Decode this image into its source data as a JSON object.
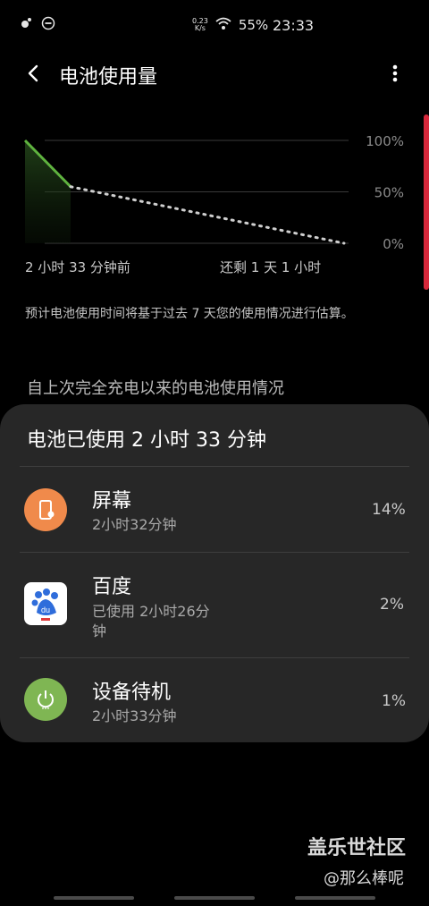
{
  "status_bar": {
    "speed_value": "0.23",
    "speed_unit": "K/s",
    "battery": "55%",
    "time": "23:33"
  },
  "app_bar": {
    "title": "电池使用量"
  },
  "chart_data": {
    "type": "line",
    "x_start_label": "2 小时 33 分钟前",
    "x_end_label": "还剩 1 天 1 小时",
    "y_tick_labels": [
      "100%",
      "50%",
      "0%"
    ],
    "ylim": [
      0,
      100
    ],
    "series": [
      {
        "values": [
          [
            0,
            100
          ],
          [
            1,
            55
          ]
        ]
      },
      {
        "values": [
          [
            1,
            55
          ],
          [
            7,
            0
          ]
        ]
      }
    ],
    "colors": {
      "actual": "#5fb33f",
      "predicted": "#cfcfcf",
      "grid": "#3a3a3a"
    }
  },
  "note": "预计电池使用时间将基于过去 7 天您的使用情况进行估算。",
  "section_title": "自上次完全充电以来的电池使用情况",
  "card": {
    "title": "电池已使用 2 小时 33 分钟",
    "items": [
      {
        "name": "屏幕",
        "detail": "2小时32分钟",
        "percent": "14%",
        "icon": "screen-icon",
        "icon_color": "#f08a4b"
      },
      {
        "name": "百度",
        "detail": "已使用 2小时26分\n钟",
        "percent": "2%",
        "icon": "baidu-icon",
        "icon_color": "#ffffff"
      },
      {
        "name": "设备待机",
        "detail": "2小时33分钟",
        "percent": "1%",
        "icon": "power-icon",
        "icon_color": "#7fb653"
      }
    ]
  },
  "watermark": {
    "line1": "盖乐世社区",
    "line2": "@那么棒呢"
  },
  "colors": {
    "background": "#000000",
    "card": "#272727",
    "accent_red": "#d6283b"
  }
}
